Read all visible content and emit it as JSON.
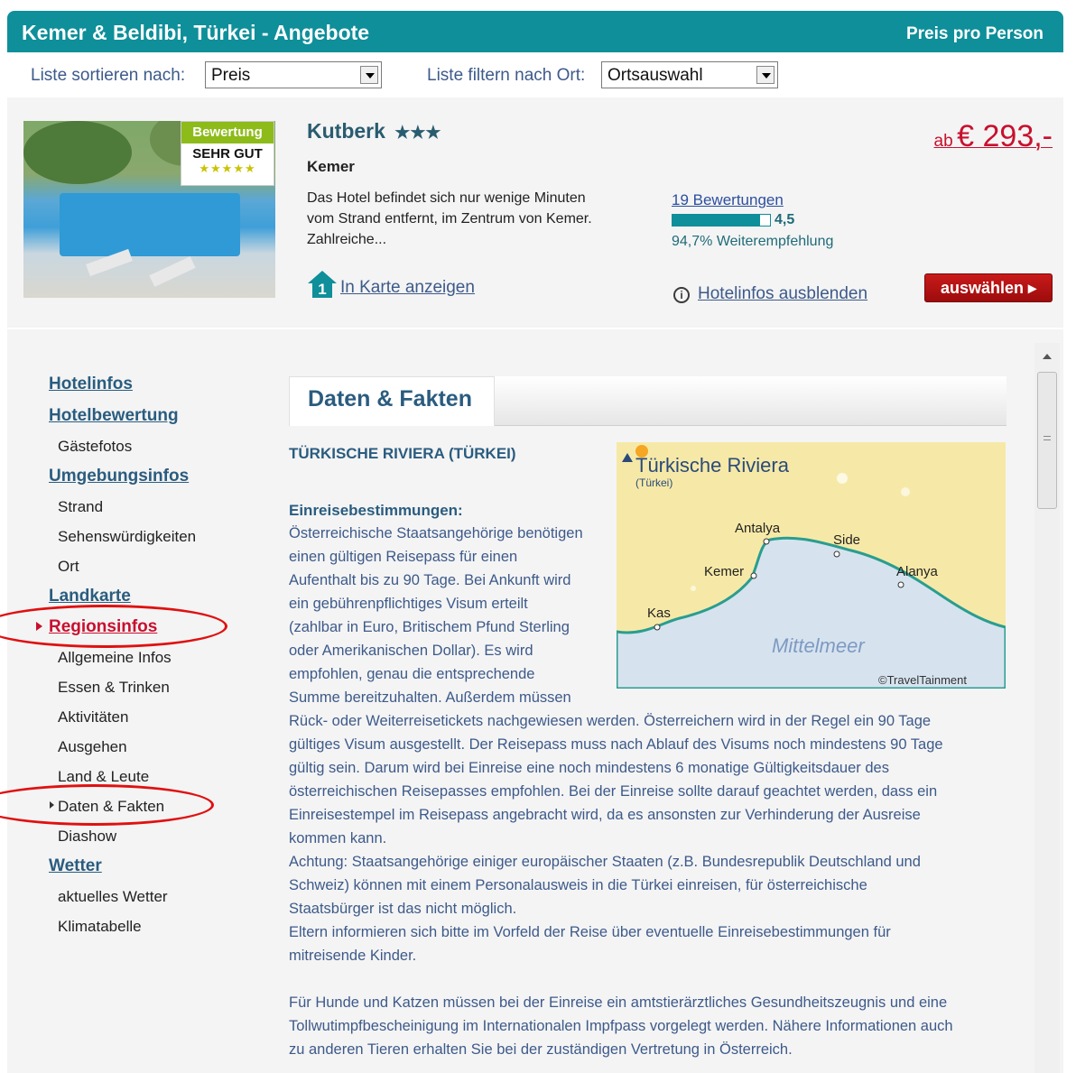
{
  "header": {
    "title": "Kemer & Beldibi, Türkei - Angebote",
    "price_note": "Preis pro Person"
  },
  "controls": {
    "sort_label": "Liste sortieren nach:",
    "sort_value": "Preis",
    "filter_label": "Liste filtern nach Ort:",
    "filter_value": "Ortsauswahl"
  },
  "hotel": {
    "badge_title": "Bewertung",
    "badge_text": "SEHR GUT",
    "badge_stars": "★★★★★",
    "name": "Kutberk",
    "stars": "★★★",
    "location": "Kemer",
    "description": "Das Hotel befindet sich nur wenige Minuten vom Strand entfernt, im Zentrum von Kemer. Zahlreiche...",
    "map_badge": "1",
    "map_link": "In Karte anzeigen",
    "reviews_link": "19 Bewertungen",
    "rating_value": "4,5",
    "rating_fraction": 0.9,
    "recommendation": "94,7% Weiterempfehlung",
    "info_icon": "i",
    "hide_info_link": "Hotelinfos ausblenden",
    "price_prefix": "ab",
    "price": "€ 293,-",
    "select_button": "auswählen ▸"
  },
  "sidebar": {
    "hotelinfos": "Hotelinfos",
    "hotelbewertung": "Hotelbewertung",
    "gaestefotos": "Gästefotos",
    "umgebungsinfos": "Umgebungsinfos",
    "strand": "Strand",
    "sehenswuerdigkeiten": "Sehenswürdigkeiten",
    "ort": "Ort",
    "landkarte": "Landkarte",
    "regionsinfos": "Regionsinfos",
    "allgemeine": "Allgemeine Infos",
    "essen": "Essen & Trinken",
    "aktivitaeten": "Aktivitäten",
    "ausgehen": "Ausgehen",
    "land": "Land & Leute",
    "daten": "Daten & Fakten",
    "diashow": "Diashow",
    "wetter": "Wetter",
    "aktuelles": "aktuelles Wetter",
    "klimatabelle": "Klimatabelle"
  },
  "main": {
    "tab": "Daten & Fakten",
    "region_title": "TÜRKISCHE RIVIERA (TÜRKEI)",
    "section_heading": "Einreisebestimmungen:",
    "para1_lines": [
      "Österreichische Staatsangehörige benötigen",
      "einen gültigen Reisepass für einen",
      "Aufenthalt bis zu 90 Tage. Bei Ankunft wird",
      "ein gebührenpflichtiges Visum erteilt",
      "(zahlbar in Euro, Britischem Pfund Sterling",
      "oder Amerikanischen Dollar). Es wird",
      "empfohlen, genau die entsprechende",
      "Summe bereitzuhalten. Außerdem müssen"
    ],
    "para1_rest_lines": [
      "Rück- oder Weiterreisetickets nachgewiesen werden. Österreichern wird in der Regel ein 90 Tage",
      "gültiges Visum ausgestellt. Der Reisepass muss nach Ablauf des Visums noch mindestens 90 Tage",
      "gültig sein. Darum wird bei Einreise eine noch mindestens 6 monatige Gültigkeitsdauer des",
      "österreichischen Reisepasses empfohlen. Bei der Einreise sollte darauf geachtet werden, dass ein",
      "Einreisestempel im Reisepass angebracht wird, da es ansonsten zur Verhinderung der Ausreise",
      "kommen kann.",
      "Achtung: Staatsangehörige einiger europäischer Staaten (z.B. Bundesrepublik Deutschland und",
      "Schweiz) können mit einem Personalausweis in die Türkei einreisen, für österreichische",
      "Staatsbürger ist das nicht möglich.",
      "Eltern informieren sich bitte im Vorfeld der Reise über eventuelle Einreisebestimmungen für",
      "mitreisende Kinder."
    ],
    "para2_lines": [
      "Für Hunde und Katzen müssen bei der Einreise ein amtstierärztliches Gesundheitszeugnis und eine",
      "Tollwutimpfbescheinigung im Internationalen Impfpass vorgelegt werden. Nähere Informationen auch",
      "zu anderen Tieren erhalten Sie bei der zuständigen Vertretung in Österreich."
    ]
  },
  "map": {
    "title": "Türkische Riviera",
    "subtitle": "(Türkei)",
    "cities": [
      "Antalya",
      "Side",
      "Kemer",
      "Alanya",
      "Kas"
    ],
    "sea": "Mittelmeer",
    "copyright": "©TravelTainment"
  },
  "colors": {
    "header_bg": "#0e8f9a",
    "price_red": "#c8102e",
    "link_blue": "#2a5c7f",
    "annotation_red": "#e01010"
  }
}
